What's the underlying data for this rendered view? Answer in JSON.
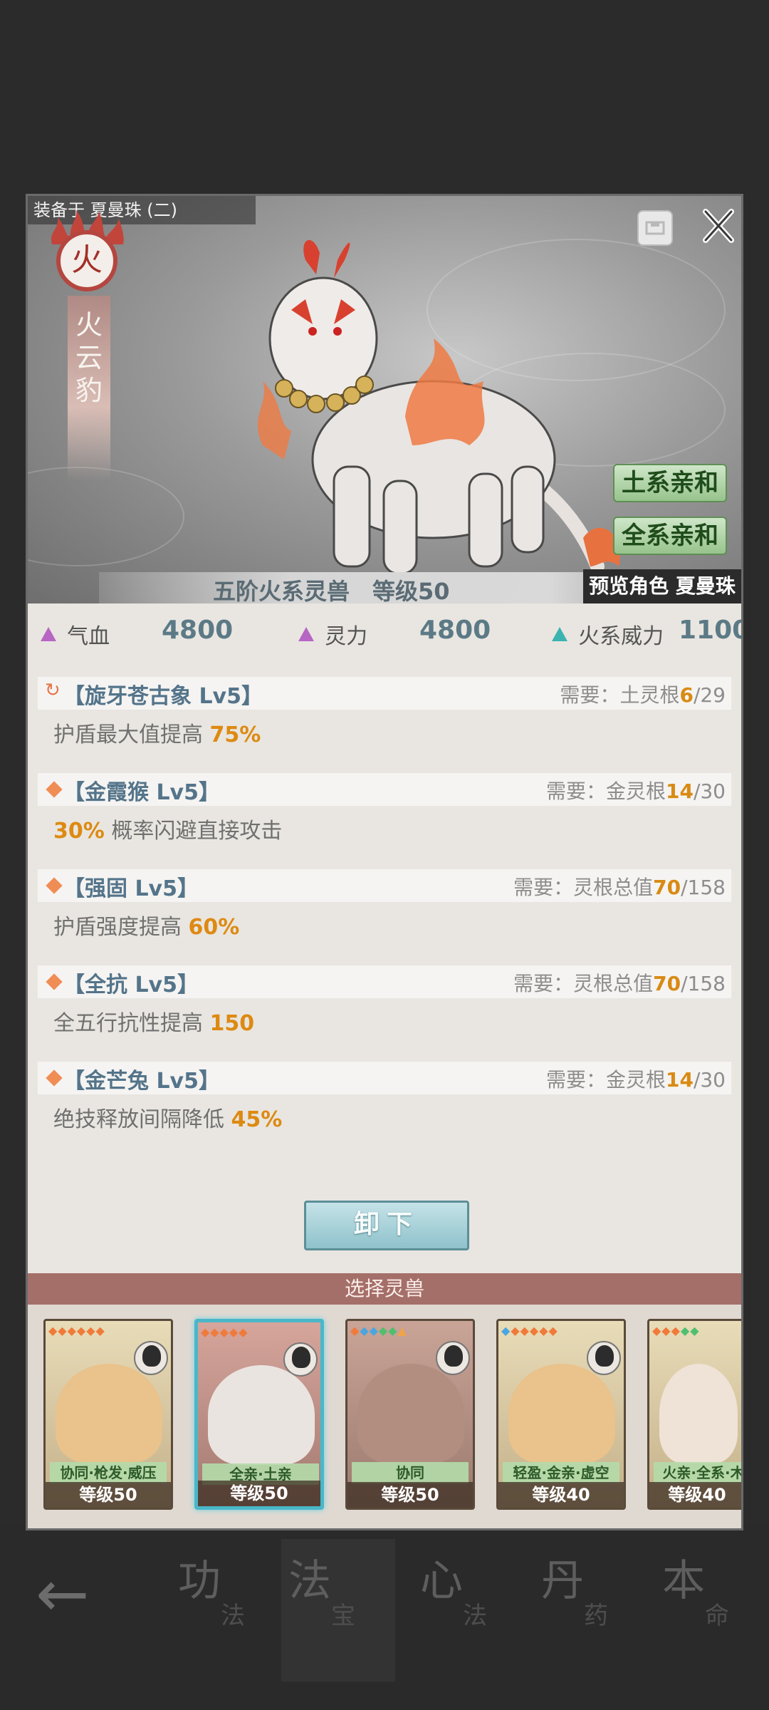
{
  "header": {
    "equipped_label": "装备于 夏曼珠 (二)"
  },
  "beast": {
    "element_glyph": "火",
    "name": "火云豹",
    "rank_text": "五阶火系灵兽　等级50",
    "preview_label": "预览角色 夏曼珠",
    "affinities": [
      "土系亲和",
      "全系亲和"
    ]
  },
  "stats": [
    {
      "label": "气血",
      "value": "4800",
      "color": "#b766c4"
    },
    {
      "label": "灵力",
      "value": "4800",
      "color": "#b766c4"
    },
    {
      "label": "火系威力",
      "value": "1100",
      "color": "#3bb4b0"
    }
  ],
  "skills": [
    {
      "name": "【旋牙苍古象 Lv5】",
      "req_label": "需要：",
      "req_attr": "土灵根",
      "req_have": "6",
      "req_total": "/29",
      "desc_pre": "护盾最大值提高 ",
      "desc_hl": "75%",
      "desc_post": ""
    },
    {
      "name": "【金霞猴 Lv5】",
      "req_label": "需要：",
      "req_attr": "金灵根",
      "req_have": "14",
      "req_total": "/30",
      "desc_pre": "",
      "desc_hl": "30%",
      "desc_post": " 概率闪避直接攻击"
    },
    {
      "name": "【强固 Lv5】",
      "req_label": "需要：",
      "req_attr": "灵根总值",
      "req_have": "70",
      "req_total": "/158",
      "desc_pre": "护盾强度提高 ",
      "desc_hl": "60%",
      "desc_post": ""
    },
    {
      "name": "【全抗 Lv5】",
      "req_label": "需要：",
      "req_attr": "灵根总值",
      "req_have": "70",
      "req_total": "/158",
      "desc_pre": "全五行抗性提高 ",
      "desc_hl": "150",
      "desc_post": ""
    },
    {
      "name": "【金芒兔 Lv5】",
      "req_label": "需要：",
      "req_attr": "金灵根",
      "req_have": "14",
      "req_total": "/30",
      "desc_pre": "绝技释放间隔降低 ",
      "desc_hl": "45%",
      "desc_post": ""
    }
  ],
  "unequip_label": "卸下",
  "select_title": "选择灵兽",
  "cards": [
    {
      "traits": "协同·枪发·威压",
      "level": "等级50",
      "selected": false
    },
    {
      "traits": "全亲·土亲",
      "level": "等级50",
      "selected": true
    },
    {
      "traits": "协同",
      "level": "等级50",
      "selected": false
    },
    {
      "traits": "轻盈·金亲·虚空",
      "level": "等级40",
      "selected": false
    },
    {
      "traits": "火亲·全系·木",
      "level": "等级40",
      "selected": false
    }
  ],
  "nav": {
    "items": [
      {
        "big": "功",
        "small": "法"
      },
      {
        "big": "法",
        "small": "宝"
      },
      {
        "big": "心",
        "small": "法"
      },
      {
        "big": "丹",
        "small": "药"
      },
      {
        "big": "本",
        "small": "命"
      }
    ]
  },
  "icons": {
    "close": "close-icon",
    "save": "save-icon",
    "back": "back-arrow-icon"
  }
}
